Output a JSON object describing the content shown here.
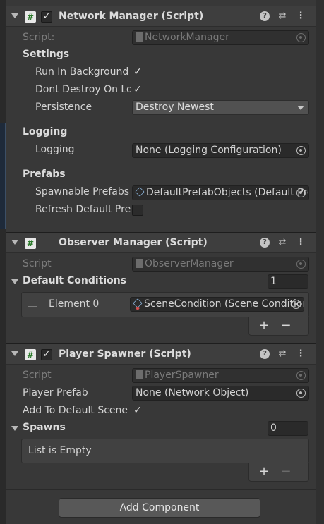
{
  "network_manager": {
    "title": "Network Manager (Script)",
    "enabled": true,
    "script_label": "Script:",
    "script_value": "NetworkManager",
    "settings_heading": "Settings",
    "run_in_background_label": "Run In Background",
    "run_in_background": true,
    "dont_destroy_label": "Dont Destroy On Load",
    "dont_destroy": true,
    "persistence_label": "Persistence",
    "persistence_value": "Destroy Newest",
    "logging_heading": "Logging",
    "logging_label": "Logging",
    "logging_value": "None (Logging Configuration)",
    "prefabs_heading": "Prefabs",
    "spawnable_label": "Spawnable Prefabs",
    "spawnable_value": "DefaultPrefabObjects (Default Prefab Objects)",
    "refresh_label": "Refresh Default Prefabs",
    "refresh": false
  },
  "observer_manager": {
    "title": "Observer Manager (Script)",
    "script_label": "Script",
    "script_value": "ObserverManager",
    "default_conditions_label": "Default Conditions",
    "default_conditions_size": "1",
    "element_label": "Element 0",
    "element_value": "SceneCondition (Scene Condition)",
    "add_label": "+",
    "remove_label": "−"
  },
  "player_spawner": {
    "title": "Player Spawner (Script)",
    "enabled": true,
    "script_label": "Script",
    "script_value": "PlayerSpawner",
    "player_prefab_label": "Player Prefab",
    "player_prefab_value": "None (Network Object)",
    "add_to_default_label": "Add To Default Scene",
    "add_to_default": true,
    "spawns_label": "Spawns",
    "spawns_size": "0",
    "empty_label": "List is Empty",
    "add_label": "+",
    "remove_label": "−"
  },
  "add_component_label": "Add Component",
  "icons": {
    "script": "#",
    "check": "✓",
    "help": "?",
    "presets": "⇄",
    "menu": "⋮"
  }
}
